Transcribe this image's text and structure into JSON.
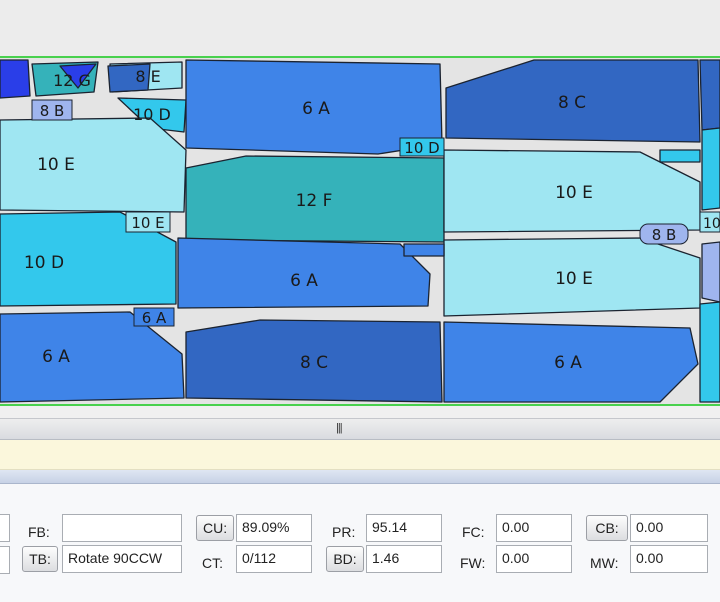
{
  "colors": {
    "light_cyan": "#9fe6f2",
    "cyan": "#33c8ec",
    "teal": "#35b2ba",
    "blue": "#3f84e8",
    "dark_blue": "#3267c2",
    "navy": "#2a3ee8",
    "label_box": "#9fb5ee",
    "sheet": "#e4e4e4",
    "border_green": "#49d14e",
    "info_band": "#fbf7dc"
  },
  "marker": {
    "pieces": [
      {
        "label": "6 A",
        "shade": "blue"
      },
      {
        "label": "8 C",
        "shade": "dark_blue"
      },
      {
        "label": "10 E",
        "shade": "light_cyan"
      },
      {
        "label": "12 F",
        "shade": "teal"
      },
      {
        "label": "10 E",
        "shade": "light_cyan"
      },
      {
        "label": "10 D",
        "shade": "cyan"
      },
      {
        "label": "6 A",
        "shade": "blue"
      },
      {
        "label": "10 E",
        "shade": "light_cyan"
      },
      {
        "label": "6 A",
        "shade": "blue"
      },
      {
        "label": "8 C",
        "shade": "dark_blue"
      },
      {
        "label": "6 A",
        "shade": "blue"
      },
      {
        "label": "12 G",
        "shade": "teal"
      },
      {
        "label": "8 E",
        "shade": "light_cyan"
      },
      {
        "label": "10 D",
        "shade": "cyan"
      }
    ],
    "small_tags": [
      "8 B",
      "10 D",
      "10 E",
      "6 A",
      "8 B",
      "10"
    ]
  },
  "splitter": {
    "grip": "|||"
  },
  "params": {
    "fb_label": "FB:",
    "fb_value": "",
    "tb_button": "TB:",
    "tb_value": "Rotate 90CCW",
    "cu_button": "CU:",
    "cu_value": "89.09%",
    "ct_label": "CT:",
    "ct_value": "0/112",
    "pr_label": "PR:",
    "pr_value": "95.14",
    "bd_button": "BD:",
    "bd_value": "1.46",
    "fc_label": "FC:",
    "fc_value": "0.00",
    "fw_label": "FW:",
    "fw_value": "0.00",
    "cb_button": "CB:",
    "cb_value": "0.00",
    "mw_label": "MW:",
    "mw_value": "0.00"
  }
}
